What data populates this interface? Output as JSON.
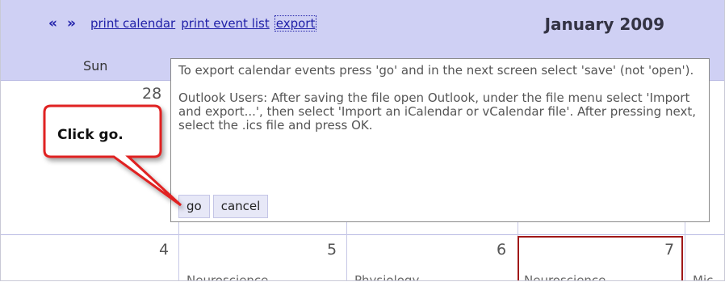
{
  "nav": {
    "prev_label": "«",
    "next_label": "»",
    "print_calendar": "print calendar",
    "print_event_list": "print event list",
    "export": "export"
  },
  "month_title": "January 2009",
  "day_header": "Sun",
  "week1": {
    "sun_number": "28"
  },
  "week2": {
    "sun_number": "4",
    "mon_number": "5",
    "tue_number": "6",
    "wed_number": "7",
    "mon_event": "Neuroscience",
    "tue_event": "Physiology",
    "wed_event": "Neuroscience",
    "thu_event": "Mic"
  },
  "popup": {
    "para1": "To export calendar events press 'go' and in the next screen select 'save' (not 'open').",
    "para2": "Outlook Users: After saving the file open Outlook, under the file menu select 'Import and export...', then select 'Import an iCalendar or vCalendar file'. After pressing next, select the .ics file and press OK.",
    "go": "go",
    "cancel": "cancel"
  },
  "callout": {
    "text": "Click go.",
    "border_color": "#e02020"
  },
  "colors": {
    "header_bg": "#cfd0f4",
    "link": "#2020a8",
    "today_border": "#a01818"
  }
}
